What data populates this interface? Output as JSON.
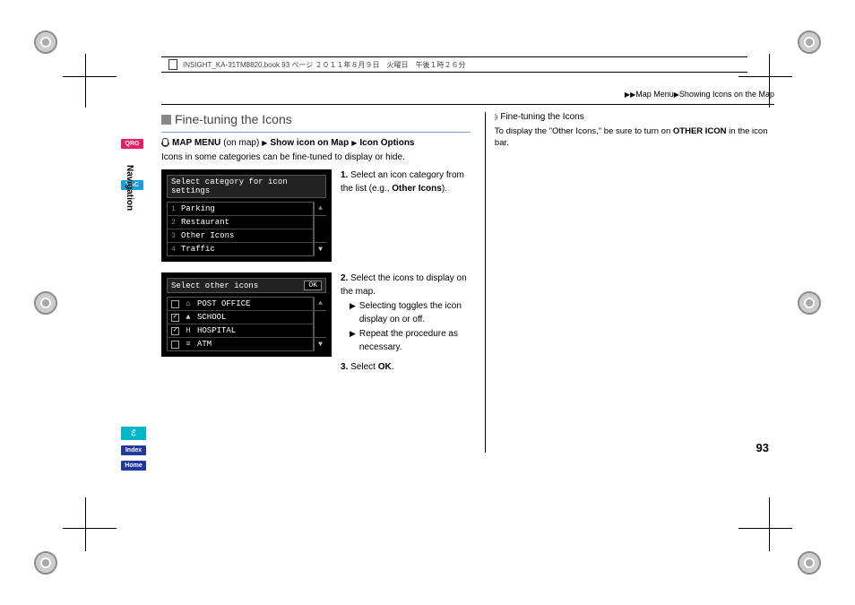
{
  "fileinfo": "INSIGHT_KA-31TM8820.book  93 ページ  ２０１１年８月９日　火曜日　午後１時２６分",
  "breadcrumb": {
    "pre": "▶▶",
    "a": "Map Menu",
    "sep": "▶",
    "b": "Showing Icons on the Map"
  },
  "sidebar": {
    "qrg": "QRG",
    "toc": "TOC",
    "nav_label": "Navigation",
    "voice": "ℰ",
    "index": "Index",
    "home": "Home"
  },
  "section_title": "Fine-tuning the Icons",
  "nav_path": {
    "a": "MAP MENU",
    "a_note": "(on map)",
    "b": "Show icon on Map",
    "c": "Icon Options"
  },
  "intro": "Icons in some categories can be fine-tuned to display or hide.",
  "screen1": {
    "title": "Select category for icon settings",
    "rows": [
      "Parking",
      "Restaurant",
      "Other Icons",
      "Traffic"
    ]
  },
  "screen2": {
    "title": "Select other icons",
    "ok": "OK",
    "rows": [
      {
        "checked": false,
        "icon": "⌂",
        "label": "POST OFFICE"
      },
      {
        "checked": true,
        "icon": "▲",
        "label": "SCHOOL"
      },
      {
        "checked": true,
        "icon": "H",
        "label": "HOSPITAL"
      },
      {
        "checked": false,
        "icon": "≡",
        "label": "ATM"
      }
    ]
  },
  "steps": {
    "s1_num": "1.",
    "s1_text": "Select an icon category from the list (e.g., ",
    "s1_bold": "Other Icons",
    "s1_end": ").",
    "s2_num": "2.",
    "s2_text": "Select the icons to display on the map.",
    "s2_b1": "Selecting toggles the icon display on or off.",
    "s2_b2": "Repeat the procedure as necessary.",
    "s3_num": "3.",
    "s3_text": "Select ",
    "s3_bold": "OK",
    "s3_end": "."
  },
  "right": {
    "marker": "⦈",
    "title": "Fine-tuning the Icons",
    "body_a": "To display the \"Other Icons,\" be sure to turn on ",
    "body_bold": "OTHER ICON",
    "body_b": " in the icon bar."
  },
  "page_number": "93"
}
